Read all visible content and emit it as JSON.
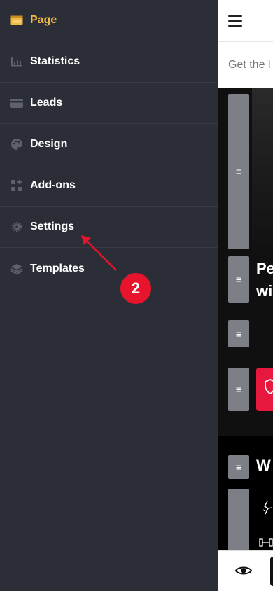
{
  "sidebar": {
    "items": [
      {
        "label": "Page",
        "icon": "page-window-icon",
        "active": true
      },
      {
        "label": "Statistics",
        "icon": "bar-chart-icon"
      },
      {
        "label": "Leads",
        "icon": "credit-card-icon"
      },
      {
        "label": "Design",
        "icon": "palette-icon"
      },
      {
        "label": "Add-ons",
        "icon": "grid-plus-icon"
      },
      {
        "label": "Settings",
        "icon": "gear-icon"
      },
      {
        "label": "Templates",
        "icon": "layers-icon"
      }
    ]
  },
  "preview": {
    "subbar_text": "Get the l",
    "hero_text_line1": "Pe",
    "hero_text_line2": "wi",
    "section2_title": "W",
    "handle_glyph": "≡"
  },
  "annotation": {
    "step_number": "2"
  },
  "colors": {
    "accent": "#f2b846",
    "marker": "#e8142e",
    "sidebar_bg": "#2b2e36"
  }
}
